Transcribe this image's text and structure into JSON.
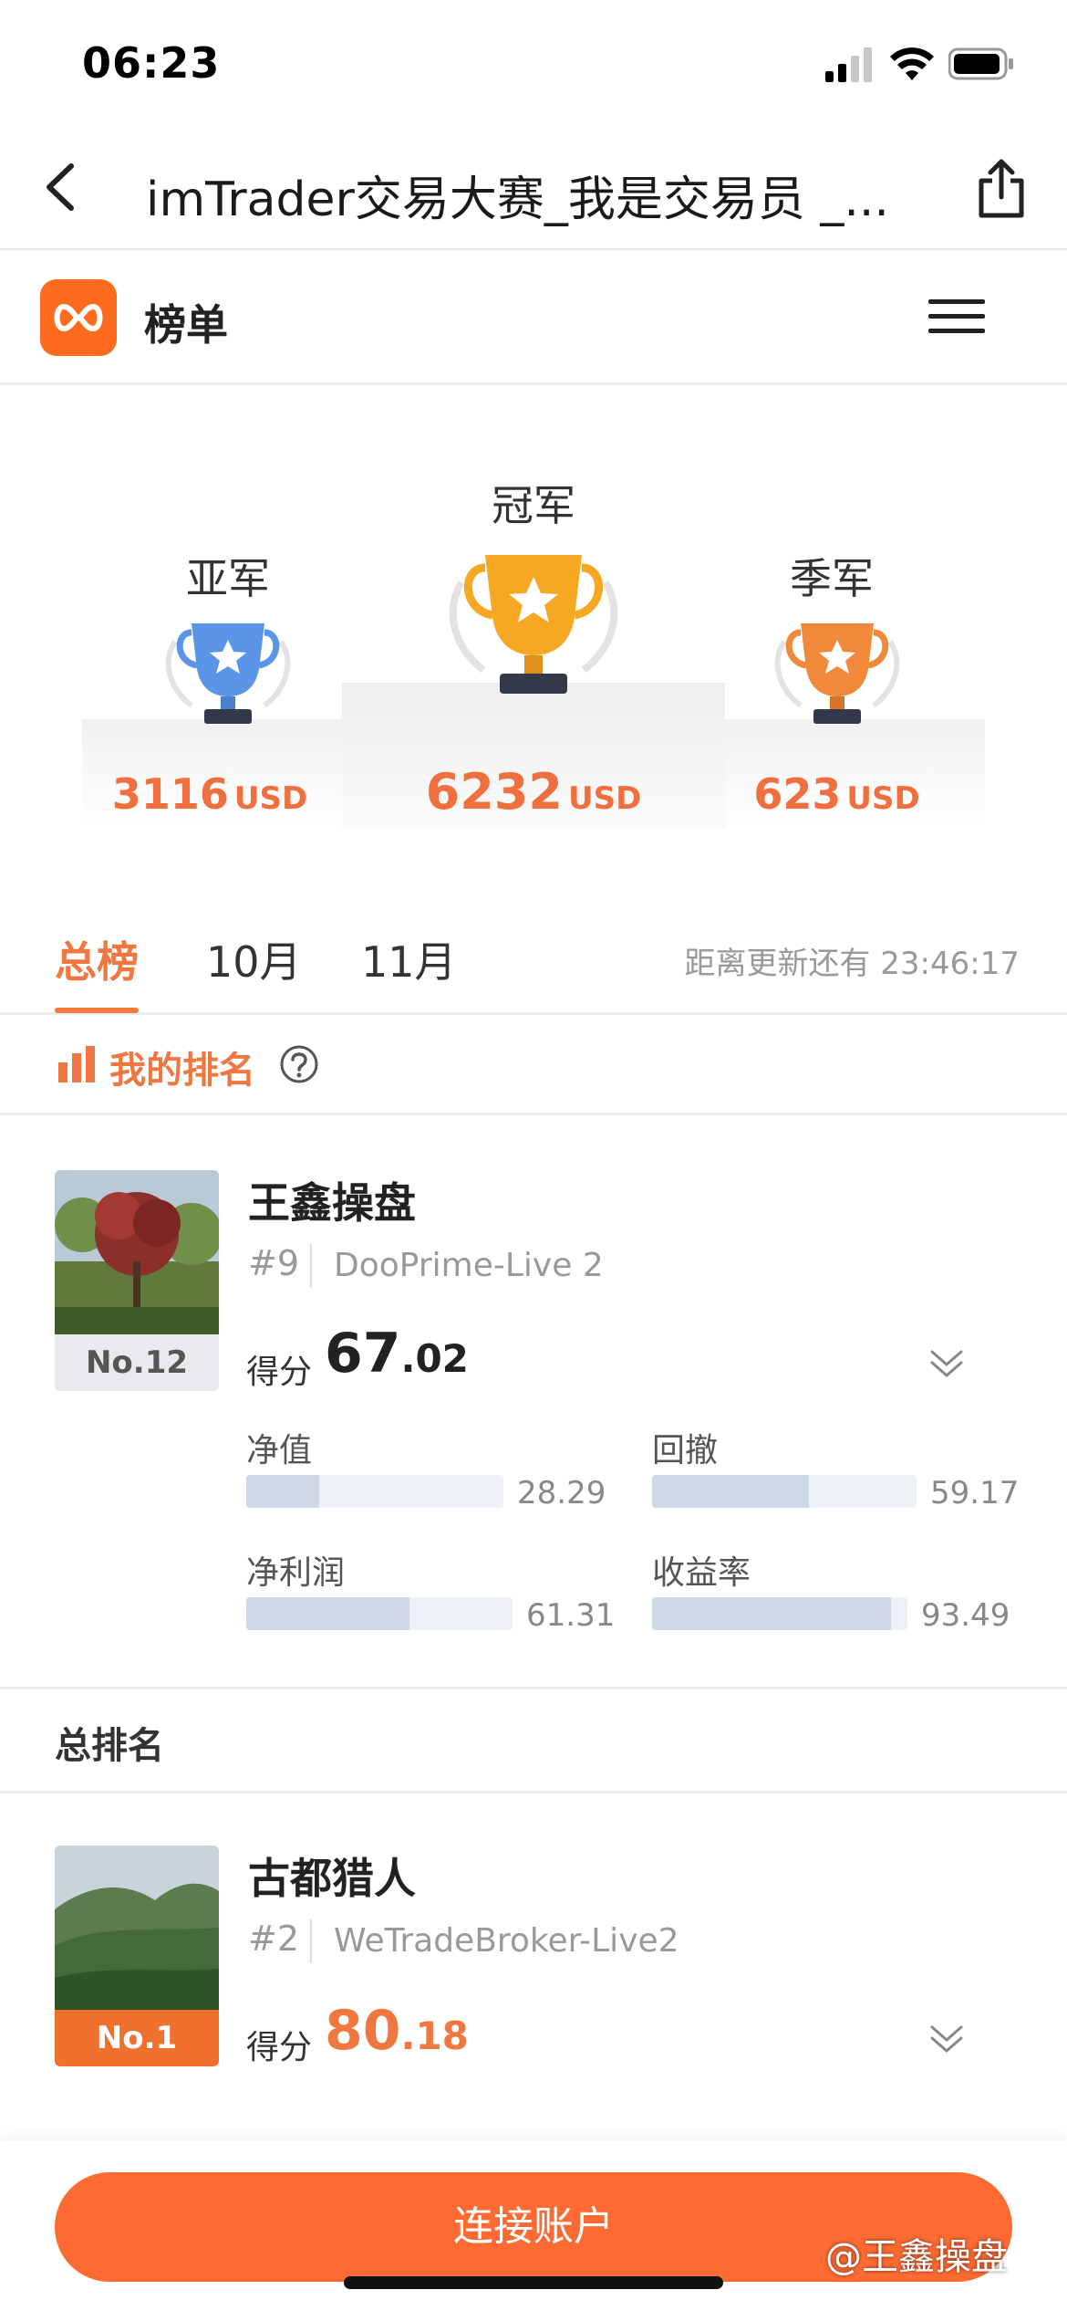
{
  "status_bar": {
    "time": "06:23"
  },
  "nav": {
    "title": "imTrader交易大赛_我是交易员 _..."
  },
  "header": {
    "title": "榜单"
  },
  "podium": {
    "second": {
      "label": "亚军",
      "amount": "3116",
      "unit": "USD"
    },
    "first": {
      "label": "冠军",
      "amount": "6232",
      "unit": "USD"
    },
    "third": {
      "label": "季军",
      "amount": "623",
      "unit": "USD"
    }
  },
  "tabs": {
    "items": [
      {
        "label": "总榜",
        "active": true
      },
      {
        "label": "10月",
        "active": false
      },
      {
        "label": "11月",
        "active": false
      }
    ],
    "countdown_label": "距离更新还有",
    "countdown_value": "23:46:17"
  },
  "my_ranking": {
    "title": "我的排名",
    "trader": {
      "name": "王鑫操盘",
      "rank": "#9",
      "broker": "DooPrime-Live 2",
      "badge": "No.12",
      "score_label": "得分",
      "score_int": "67",
      "score_dec": ".02",
      "metrics": [
        {
          "label": "净值",
          "value": "28.29",
          "fraction": 0.2829
        },
        {
          "label": "回撤",
          "value": "59.17",
          "fraction": 0.5917
        },
        {
          "label": "净利润",
          "value": "61.31",
          "fraction": 0.6131
        },
        {
          "label": "收益率",
          "value": "93.49",
          "fraction": 0.9349
        }
      ]
    }
  },
  "total_ranking": {
    "title": "总排名",
    "first_trader": {
      "name": "古都猎人",
      "rank": "#2",
      "broker": "WeTradeBroker-Live2",
      "badge": "No.1",
      "score_label": "得分",
      "score_int": "80",
      "score_dec": ".18"
    }
  },
  "bottom": {
    "connect_label": "连接账户"
  },
  "watermark": "@王鑫操盘",
  "colors": {
    "accent": "#f0773f",
    "button": "#fd6b33",
    "gold": "#f7a823",
    "silver": "#5b95e8",
    "bronze": "#f08a3a"
  }
}
